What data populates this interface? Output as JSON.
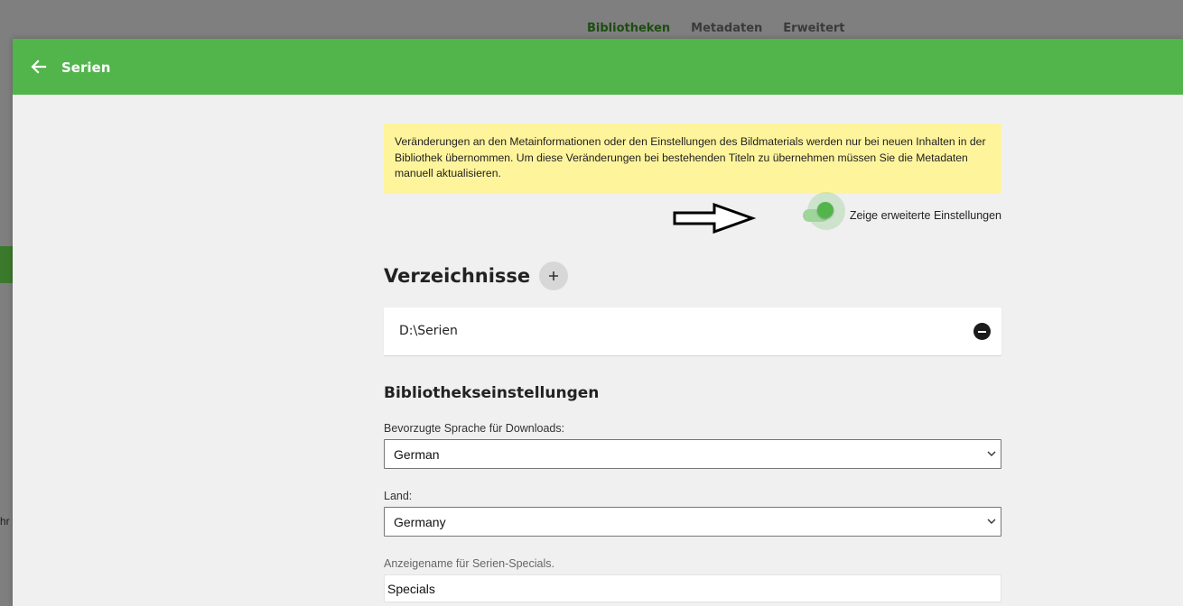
{
  "background": {
    "tabs": [
      {
        "label": "Bibliotheken"
      },
      {
        "label": "Metadaten"
      },
      {
        "label": "Erweitert"
      }
    ],
    "left_fragment": "hr"
  },
  "dialog": {
    "title": "Serien",
    "notice": "Veränderungen an den Metainformationen oder den Einstellungen des Bildmaterials werden nur bei neuen Inhalten in der Bibliothek übernommen. Um diese Veränderungen bei bestehenden Titeln zu übernehmen müssen Sie die Metadaten manuell aktualisieren.",
    "advanced_toggle": {
      "label": "Zeige erweiterte Einstellungen",
      "checked": true
    },
    "folders": {
      "title": "Verzeichnisse",
      "items": [
        {
          "path": "D:\\Serien"
        }
      ]
    },
    "library_settings": {
      "title": "Bibliothekseinstellungen",
      "language": {
        "label": "Bevorzugte Sprache für Downloads:",
        "value": "German"
      },
      "country": {
        "label": "Land:",
        "value": "Germany"
      },
      "specials": {
        "label": "Anzeigename für Serien-Specials.",
        "value": "Specials"
      }
    }
  },
  "colors": {
    "accent": "#52b54b",
    "notice_bg": "#fef49c",
    "dialog_bg": "#f0f0f0"
  },
  "icons": [
    "back-arrow-icon",
    "plus-icon",
    "minus-circle-icon",
    "chevron-down-icon",
    "annotation-arrow-icon"
  ]
}
